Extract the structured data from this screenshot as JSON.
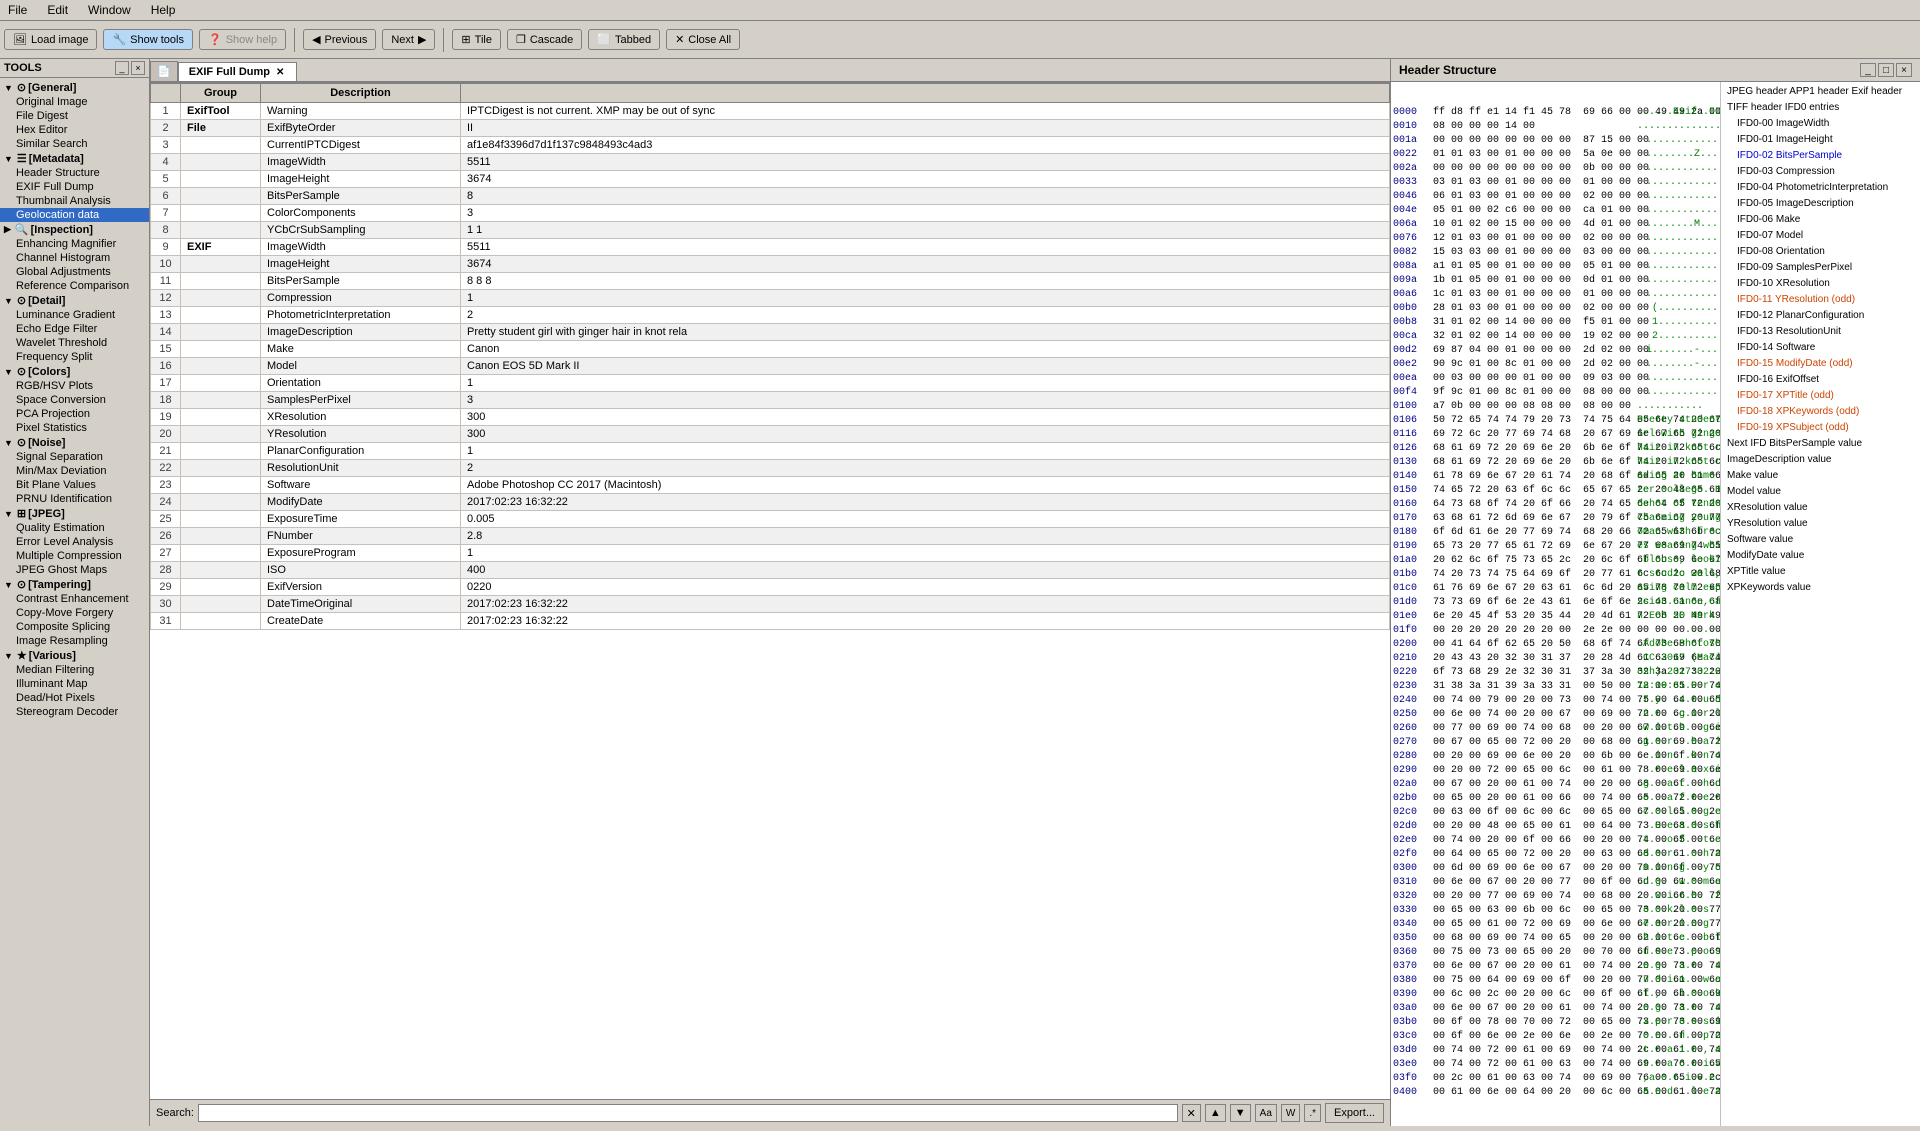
{
  "menubar": {
    "items": [
      "File",
      "Edit",
      "Window",
      "Help"
    ]
  },
  "toolbar": {
    "load_image": "Load image",
    "show_tools": "Show tools",
    "show_help": "Show help",
    "previous": "Previous",
    "next": "Next",
    "tile": "Tile",
    "cascade": "Cascade",
    "tabbed": "Tabbed",
    "close_all": "Close All"
  },
  "left_panel": {
    "title": "TOOLS",
    "categories": [
      {
        "id": "general",
        "label": "[General]",
        "expanded": true,
        "children": [
          "Original Image",
          "File Digest",
          "Hex Editor",
          "Similar Search"
        ]
      },
      {
        "id": "metadata",
        "label": "[Metadata]",
        "expanded": true,
        "children": [
          "Header Structure",
          "EXIF Full Dump",
          "Thumbnail Analysis",
          "Geolocation data"
        ]
      },
      {
        "id": "inspection",
        "label": "[Inspection]",
        "expanded": true,
        "children": [
          "Enhancing Magnifier",
          "Channel Histogram",
          "Global Adjustments",
          "Reference Comparison"
        ]
      },
      {
        "id": "detail",
        "label": "[Detail]",
        "expanded": true,
        "children": [
          "Luminance Gradient",
          "Echo Edge Filter",
          "Wavelet Threshold",
          "Frequency Split"
        ]
      },
      {
        "id": "colors",
        "label": "[Colors]",
        "expanded": true,
        "children": [
          "RGB/HSV Plots",
          "Space Conversion",
          "PCA Projection",
          "Pixel Statistics"
        ]
      },
      {
        "id": "noise",
        "label": "[Noise]",
        "expanded": true,
        "children": [
          "Signal Separation",
          "Min/Max Deviation",
          "Bit Plane Values",
          "PRNU Identification"
        ]
      },
      {
        "id": "jpeg",
        "label": "[JPEG]",
        "expanded": true,
        "children": [
          "Quality Estimation",
          "Error Level Analysis",
          "Multiple Compression",
          "JPEG Ghost Maps"
        ]
      },
      {
        "id": "tampering",
        "label": "[Tampering]",
        "expanded": true,
        "children": [
          "Contrast Enhancement",
          "Copy-Move Forgery",
          "Composite Splicing",
          "Image Resampling"
        ]
      },
      {
        "id": "various",
        "label": "[Various]",
        "expanded": true,
        "children": [
          "Median Filtering",
          "Illuminant Map",
          "Dead/Hot Pixels",
          "Stereogram Decoder"
        ]
      }
    ]
  },
  "center": {
    "tab_label": "EXIF Full Dump",
    "table_headers": [
      "",
      "Group",
      "Description",
      "Value"
    ],
    "rows": [
      {
        "num": 1,
        "group": "ExifTool",
        "bold_group": true,
        "desc": "Warning",
        "value": "IPTCDigest is not current. XMP may be out of sync"
      },
      {
        "num": 2,
        "group": "File",
        "bold_group": true,
        "desc": "ExifByteOrder",
        "value": "II"
      },
      {
        "num": 3,
        "group": "",
        "desc": "CurrentIPTCDigest",
        "value": "af1e84f3396d7d1f137c9848493c4ad3"
      },
      {
        "num": 4,
        "group": "",
        "desc": "ImageWidth",
        "value": "5511"
      },
      {
        "num": 5,
        "group": "",
        "desc": "ImageHeight",
        "value": "3674"
      },
      {
        "num": 6,
        "group": "",
        "desc": "BitsPerSample",
        "value": "8"
      },
      {
        "num": 7,
        "group": "",
        "desc": "ColorComponents",
        "value": "3"
      },
      {
        "num": 8,
        "group": "",
        "desc": "YCbCrSubSampling",
        "value": "1 1"
      },
      {
        "num": 9,
        "group": "EXIF",
        "bold_group": true,
        "desc": "ImageWidth",
        "value": "5511"
      },
      {
        "num": 10,
        "group": "",
        "desc": "ImageHeight",
        "value": "3674"
      },
      {
        "num": 11,
        "group": "",
        "desc": "BitsPerSample",
        "value": "8 8 8"
      },
      {
        "num": 12,
        "group": "",
        "desc": "Compression",
        "value": "1"
      },
      {
        "num": 13,
        "group": "",
        "desc": "PhotometricInterpretation",
        "value": "2"
      },
      {
        "num": 14,
        "group": "",
        "desc": "ImageDescription",
        "value": "Pretty student girl with ginger hair in knot rela"
      },
      {
        "num": 15,
        "group": "",
        "desc": "Make",
        "value": "Canon"
      },
      {
        "num": 16,
        "group": "",
        "desc": "Model",
        "value": "Canon EOS 5D Mark II"
      },
      {
        "num": 17,
        "group": "",
        "desc": "Orientation",
        "value": "1"
      },
      {
        "num": 18,
        "group": "",
        "desc": "SamplesPerPixel",
        "value": "3"
      },
      {
        "num": 19,
        "group": "",
        "desc": "XResolution",
        "value": "300"
      },
      {
        "num": 20,
        "group": "",
        "desc": "YResolution",
        "value": "300"
      },
      {
        "num": 21,
        "group": "",
        "desc": "PlanarConfiguration",
        "value": "1"
      },
      {
        "num": 22,
        "group": "",
        "desc": "ResolutionUnit",
        "value": "2"
      },
      {
        "num": 23,
        "group": "",
        "desc": "Software",
        "value": "Adobe Photoshop CC 2017 (Macintosh)"
      },
      {
        "num": 24,
        "group": "",
        "desc": "ModifyDate",
        "value": "2017:02:23 16:32:22"
      },
      {
        "num": 25,
        "group": "",
        "desc": "ExposureTime",
        "value": "0.005"
      },
      {
        "num": 26,
        "group": "",
        "desc": "FNumber",
        "value": "2.8"
      },
      {
        "num": 27,
        "group": "",
        "desc": "ExposureProgram",
        "value": "1"
      },
      {
        "num": 28,
        "group": "",
        "desc": "ISO",
        "value": "400"
      },
      {
        "num": 29,
        "group": "",
        "desc": "ExifVersion",
        "value": "0220"
      },
      {
        "num": 30,
        "group": "",
        "desc": "DateTimeOriginal",
        "value": "2017:02:23 16:32:22"
      },
      {
        "num": 31,
        "group": "",
        "desc": "CreateDate",
        "value": "2017:02:23 16:32:22"
      }
    ],
    "search_label": "Search:",
    "search_placeholder": "",
    "export_label": "Export..."
  },
  "right_panel": {
    "title": "Header Structure",
    "hex_rows": [
      {
        "addr": "0000",
        "bytes": "ff d8 ff e1 14 f1 45 78  69 66 00 00 49 49 2a 00",
        "ascii": "......Exif..II*."
      },
      {
        "addr": "0010",
        "bytes": "08 00 00 00 14 00",
        "ascii": ".............."
      },
      {
        "addr": "001a",
        "bytes": "00 00 00 00 00 00 00 00  87 15 00 00",
        "ascii": "............"
      },
      {
        "addr": "0022",
        "bytes": "01 01 03 00 01 00 00 00  5a 0e 00 00",
        "ascii": "........Z..."
      },
      {
        "addr": "002a",
        "bytes": "00 00 00 00 00 00 00 00  0b 00 00 00",
        "ascii": "............"
      },
      {
        "addr": "0033",
        "bytes": "03 01 03 00 01 00 00 00  01 00 00 00",
        "ascii": "............"
      },
      {
        "addr": "0046",
        "bytes": "06 01 03 00 01 00 00 00  02 00 00 00",
        "ascii": "............"
      },
      {
        "addr": "004e",
        "bytes": "05 01 00 02 c6 00 00 00  ca 01 00 00",
        "ascii": "............"
      },
      {
        "addr": "006a",
        "bytes": "10 01 02 00 15 00 00 00  4d 01 00 00",
        "ascii": "........M..."
      },
      {
        "addr": "0076",
        "bytes": "12 01 03 00 01 00 00 00  02 00 00 00",
        "ascii": "............"
      },
      {
        "addr": "0082",
        "bytes": "15 03 03 00 01 00 00 00  03 00 00 00",
        "ascii": "............"
      },
      {
        "addr": "008a",
        "bytes": "a1 01 05 00 01 00 00 00  05 01 00 00",
        "ascii": "............"
      },
      {
        "addr": "009a",
        "bytes": "1b 01 05 00 01 00 00 00  0d 01 00 00",
        "ascii": "............"
      },
      {
        "addr": "00a6",
        "bytes": "1c 01 03 00 01 00 00 00  01 00 00 00",
        "ascii": "............"
      },
      {
        "addr": "00b0",
        "bytes": "28 01 03 00 01 00 00 00  02 00 00 00",
        "ascii": "(.........."
      },
      {
        "addr": "00b8",
        "bytes": "31 01 02 00 14 00 00 00  f5 01 00 00",
        "ascii": "1.........."
      },
      {
        "addr": "00ca",
        "bytes": "32 01 02 00 14 00 00 00  19 02 00 00",
        "ascii": "2.........."
      },
      {
        "addr": "00d2",
        "bytes": "69 87 04 00 01 00 00 00  2d 02 00 00",
        "ascii": "i.......-..."
      },
      {
        "addr": "00e2",
        "bytes": "90 9c 01 00 8c 01 00 00  2d 02 00 00",
        "ascii": "........-..."
      },
      {
        "addr": "00ea",
        "bytes": "00 03 00 00 00 01 00 00  09 03 00 00",
        "ascii": "............"
      },
      {
        "addr": "00f4",
        "bytes": "9f 9c 01 00 8c 01 00 00  08 00 00 00",
        "ascii": "............"
      },
      {
        "addr": "0100",
        "bytes": "a7 0b 00 00 00 08 08 00  08 00 00",
        "ascii": "..........."
      },
      {
        "addr": "0106",
        "bytes": "50 72 65 74 74 79 20 73  74 75 64 65 6e 74 20 67",
        "ascii": "Pretty student g"
      },
      {
        "addr": "0116",
        "bytes": "69 72 6c 20 77 69 74 68  20 67 69 6e 67 65 72 20",
        "ascii": "irl with ginger "
      },
      {
        "addr": "0126",
        "bytes": "68 61 69 72 20 69 6e 20  6b 6e 6f 74 20 72 65 6c",
        "ascii": "hair in knot rel"
      },
      {
        "addr": "0130",
        "bytes": "68 61 69 72 20 69 6e 20  6b 6e 6f 74 20 72 65 6c",
        "ascii": "hair in knot rel"
      },
      {
        "addr": "0140",
        "bytes": "61 78 69 6e 67 20 61 74  20 68 6f 6d 65 20 61 66",
        "ascii": "axing at home af"
      },
      {
        "addr": "0150",
        "bytes": "74 65 72 20 63 6f 6c 6c  65 67 65 2e 20 48 65 61",
        "ascii": "ter college. Hea"
      },
      {
        "addr": "0160",
        "bytes": "64 73 68 6f 74 20 6f 66  20 74 65 6e 64 65 72 20",
        "ascii": "dshot of tender "
      },
      {
        "addr": "0170",
        "bytes": "63 68 61 72 6d 69 6e 67  20 79 6f 75 6e 67 20 77",
        "ascii": "charming young w"
      },
      {
        "addr": "0180",
        "bytes": "6f 6d 61 6e 20 77 69 74  68 20 66 72 65 63 6b 6c",
        "ascii": "oman with freckl"
      },
      {
        "addr": "0190",
        "bytes": "65 73 20 77 65 61 72 69  6e 67 20 77 68 69 74 65",
        "ascii": "es wearing white"
      },
      {
        "addr": "01a0",
        "bytes": "20 62 6c 6f 75 73 65 2c  20 6c 6f 6f 6b 69 6e 67",
        "ascii": " blouse, looking"
      },
      {
        "addr": "01b0",
        "bytes": "74 20 73 74 75 64 69 6f  20 77 61 6c 6c 2c 20 68",
        "ascii": "t studio wall, h"
      },
      {
        "addr": "01c0",
        "bytes": "61 76 69 6e 67 20 63 61  6c 6d 20 65 78 70 72 65",
        "ascii": "aving calm expre"
      },
      {
        "addr": "01d0",
        "bytes": "73 73 69 6f 6e 2e 43 61  6e 6f 6e 2c 43 61 6e 6f",
        "ascii": "ssion.Canon,Cano"
      },
      {
        "addr": "01e0",
        "bytes": "6e 20 45 4f 53 20 35 44  20 4d 61 72 6b 20 49 49",
        "ascii": "n EOS 5D Mark II"
      },
      {
        "addr": "01f0",
        "bytes": "00 20 20 20 20 20 20 00  2e 2e 00 00 00 00 00 00",
        "ascii": ".       ......."
      },
      {
        "addr": "0200",
        "bytes": "00 41 64 6f 62 65 20 50  68 6f 74 6f 73 68 6f 70",
        "ascii": ".Adobe Photoshop"
      },
      {
        "addr": "0210",
        "bytes": "20 43 43 20 32 30 31 37  20 28 4d 61 63 69 6e 74",
        "ascii": " CC 2017 (Macint"
      },
      {
        "addr": "0220",
        "bytes": "6f 73 68 29 2e 32 30 31  37 3a 30 32 3a 32 33 20",
        "ascii": "osh).2017:02:23 "
      },
      {
        "addr": "0230",
        "bytes": "31 38 3a 31 39 3a 33 31  00 50 00 72 00 65 00 74",
        "ascii": "18:19:31.P.r.e.t"
      },
      {
        "addr": "0240",
        "bytes": "00 74 00 79 00 20 00 73  00 74 00 75 00 64 00 65",
        "ascii": ".t.y. .s.t.u.d.e"
      },
      {
        "addr": "0250",
        "bytes": "00 6e 00 74 00 20 00 67  00 69 00 72 00 6c 00 20",
        "ascii": ".n.t. .g.i.r.l. "
      },
      {
        "addr": "0260",
        "bytes": "00 77 00 69 00 74 00 68  00 20 00 67 00 69 00 6e",
        "ascii": ".w.i.t.h. .g.i.n"
      },
      {
        "addr": "0270",
        "bytes": "00 67 00 65 00 72 00 20  00 68 00 61 00 69 00 72",
        "ascii": ".g.e.r. .h.a.i.r"
      },
      {
        "addr": "0280",
        "bytes": "00 20 00 69 00 6e 00 20  00 6b 00 6e 00 6f 00 74",
        "ascii": ". .i.n. .k.n.o.t"
      },
      {
        "addr": "0290",
        "bytes": "00 20 00 72 00 65 00 6c  00 61 00 78 00 69 00 6e",
        "ascii": ". .r.e.l.a.x.i.n"
      },
      {
        "addr": "02a0",
        "bytes": "00 67 00 20 00 61 00 74  00 20 00 68 00 6f 00 6d",
        "ascii": ".g. .a.t. .h.o.m"
      },
      {
        "addr": "02b0",
        "bytes": "00 65 00 20 00 61 00 66  00 74 00 65 00 72 00 20",
        "ascii": ".e. .a.f.t.e.r. "
      },
      {
        "addr": "02c0",
        "bytes": "00 63 00 6f 00 6c 00 6c  00 65 00 67 00 65 00 2e",
        "ascii": ".c.o.l.l.e.g.e.."
      },
      {
        "addr": "02d0",
        "bytes": "00 20 00 48 00 65 00 61  00 64 00 73 00 68 00 6f",
        "ascii": ". .H.e.a.d.s.h.o"
      },
      {
        "addr": "02e0",
        "bytes": "00 74 00 20 00 6f 00 66  00 20 00 74 00 65 00 6e",
        "ascii": ".t. .o.f. .t.e.n"
      },
      {
        "addr": "02f0",
        "bytes": "00 64 00 65 00 72 00 20  00 63 00 68 00 61 00 72",
        "ascii": ".d.e.r. .c.h.a.r"
      },
      {
        "addr": "0300",
        "bytes": "00 6d 00 69 00 6e 00 67  00 20 00 79 00 6f 00 75",
        "ascii": ".m.i.n.g. .y.o.u"
      },
      {
        "addr": "0310",
        "bytes": "00 6e 00 67 00 20 00 77  00 6f 00 6d 00 61 00 6e",
        "ascii": ".n.g. .w.o.m.a.n"
      },
      {
        "addr": "0320",
        "bytes": "00 20 00 77 00 69 00 74  00 68 00 20 00 66 00 72",
        "ascii": ". .w.i.t.h. .f.r"
      },
      {
        "addr": "0330",
        "bytes": "00 65 00 63 00 6b 00 6c  00 65 00 73 00 20 00 77",
        "ascii": ".e.c.k.l.e.s. .w"
      },
      {
        "addr": "0340",
        "bytes": "00 65 00 61 00 72 00 69  00 6e 00 67 00 20 00 77",
        "ascii": ".e.a.r.i.n.g. .w"
      },
      {
        "addr": "0350",
        "bytes": "00 68 00 69 00 74 00 65  00 20 00 62 00 6c 00 6f",
        "ascii": ".h.i.t.e. .b.l.o"
      },
      {
        "addr": "0360",
        "bytes": "00 75 00 73 00 65 00 20  00 70 00 6f 00 73 00 69",
        "ascii": ".u.s.e. .p.o.s.i"
      },
      {
        "addr": "0370",
        "bytes": "00 6e 00 67 00 20 00 61  00 74 00 20 00 73 00 74",
        "ascii": ".n.g. .a.t. .s.t"
      },
      {
        "addr": "0380",
        "bytes": "00 75 00 64 00 69 00 6f  00 20 00 77 00 61 00 6c",
        "ascii": ".u.d.i.o. .w.a.l"
      },
      {
        "addr": "0390",
        "bytes": "00 6c 00 2c 00 20 00 6c  00 6f 00 6f 00 6b 00 69",
        "ascii": ".l.,. .l.o.o.k.i"
      },
      {
        "addr": "03a0",
        "bytes": "00 6e 00 67 00 20 00 61  00 74 00 20 00 73 00 74",
        "ascii": ".n.g. .a.t. .s.t"
      },
      {
        "addr": "03b0",
        "bytes": "00 6f 00 78 00 70 00 72  00 65 00 73 00 73 00 69",
        "ascii": ".x.p.r.e.s.s.i"
      },
      {
        "addr": "03c0",
        "bytes": "00 6f 00 6e 00 2e 00 6e  00 2e 00 70 00 6f 00 72",
        "ascii": ".o.n...n...p.o.r"
      },
      {
        "addr": "03d0",
        "bytes": "00 74 00 72 00 61 00 69  00 74 00 2c 00 61 00 74",
        "ascii": ".t.r.a.i.t.,.a.t"
      },
      {
        "addr": "03e0",
        "bytes": "00 74 00 72 00 61 00 63  00 74 00 69 00 76 00 65",
        "ascii": ".t.r.a.c.t.i.v.e"
      },
      {
        "addr": "03f0",
        "bytes": "00 2c 00 61 00 63 00 74  00 69 00 76 00 65 00 2c",
        "ascii": ".,a.c.t.i.v.e.,"
      },
      {
        "addr": "0400",
        "bytes": "00 61 00 6e 00 64 00 20  00 6c 00 65 00 61 00 72",
        "ascii": ".a.n.d. .l.e.a.r"
      }
    ],
    "struct_items": [
      {
        "label": "JPEG header APP1 header Exif header",
        "level": 0
      },
      {
        "label": "TIFF header IFD0 entries",
        "level": 0
      },
      {
        "label": "IFD0-00 ImageWidth",
        "level": 1
      },
      {
        "label": "IFD0-01 ImageHeight",
        "level": 1
      },
      {
        "label": "IFD0-02 BitsPerSample",
        "level": 1,
        "color": "blue"
      },
      {
        "label": "IFD0-03 Compression",
        "level": 1
      },
      {
        "label": "IFD0-04 PhotometricInterpretation",
        "level": 1
      },
      {
        "label": "IFD0-05 ImageDescription",
        "level": 1
      },
      {
        "label": "IFD0-06 Make",
        "level": 1
      },
      {
        "label": "IFD0-07 Model",
        "level": 1
      },
      {
        "label": "IFD0-08 Orientation",
        "level": 1
      },
      {
        "label": "IFD0-09 SamplesPerPixel",
        "level": 1
      },
      {
        "label": "IFD0-10 XResolution",
        "level": 1
      },
      {
        "label": "IFD0-11 YResolution (odd)",
        "level": 1,
        "color": "orange"
      },
      {
        "label": "IFD0-12 PlanarConfiguration",
        "level": 1
      },
      {
        "label": "IFD0-13 ResolutionUnit",
        "level": 1
      },
      {
        "label": "IFD0-14 Software",
        "level": 1
      },
      {
        "label": "IFD0-15 ModifyDate (odd)",
        "level": 1,
        "color": "orange"
      },
      {
        "label": "IFD0-16 ExifOffset",
        "level": 1
      },
      {
        "label": "IFD0-17 XPTitle (odd)",
        "level": 1,
        "color": "orange"
      },
      {
        "label": "IFD0-18 XPKeywords (odd)",
        "level": 1,
        "color": "orange"
      },
      {
        "label": "IFD0-19 XPSubject (odd)",
        "level": 1,
        "color": "orange"
      },
      {
        "label": "Next IFD BitsPerSample value",
        "level": 0
      },
      {
        "label": "ImageDescription value",
        "level": 0
      },
      {
        "label": "",
        "level": 0
      },
      {
        "label": "Make value",
        "level": 0
      },
      {
        "label": "Model value",
        "level": 0
      },
      {
        "label": "XResolution value",
        "level": 0
      },
      {
        "label": "YResolution value",
        "level": 0
      },
      {
        "label": "Software value",
        "level": 0
      },
      {
        "label": "ModifyDate value",
        "level": 0
      },
      {
        "label": "XPTitle value",
        "level": 0
      },
      {
        "label": "",
        "level": 0
      },
      {
        "label": "XPKeywords value",
        "level": 0
      }
    ]
  }
}
